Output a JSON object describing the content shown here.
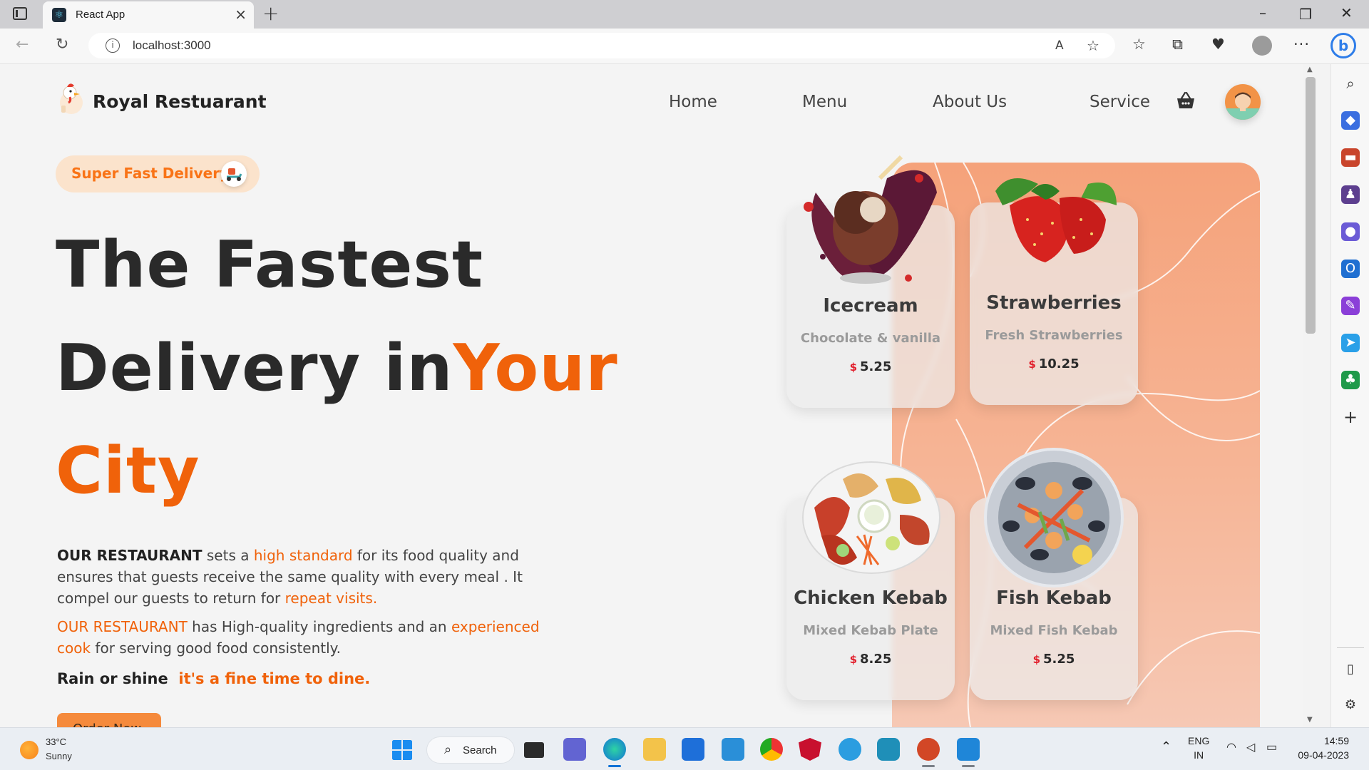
{
  "browser": {
    "tab_title": "React App",
    "url": "localhost:3000"
  },
  "site": {
    "brand": "Royal Restuarant",
    "nav": [
      "Home",
      "Menu",
      "About Us",
      "Service"
    ]
  },
  "hero": {
    "badge": "Super Fast Delivery",
    "line1": "The Fastest",
    "line2_main": "Delivery in",
    "line2_accent": "Your",
    "line3_accent": "City",
    "para1": {
      "bold": "OUR RESTAURANT",
      "t1": " sets a ",
      "hl1": "high standard",
      "t2": " for its food quality and ensures that guests receive the same quality with every meal . It compel our guests to return for ",
      "hl2": "repeat visits."
    },
    "para2": {
      "hl1": "OUR RESTAURANT",
      "t1": " has High-quality ingredients and an ",
      "hl2": "experienced cook",
      "t2": " for serving good food consistently."
    },
    "tagline_main": "Rain or shine",
    "tagline_accent": "it's a fine time to dine.",
    "cta": "Order Now"
  },
  "cards": [
    {
      "title": "Icecream",
      "subtitle": "Chocolate & vanilla",
      "currency": "$",
      "price": "5.25"
    },
    {
      "title": "Strawberries",
      "subtitle": "Fresh Strawberries",
      "currency": "$",
      "price": "10.25"
    },
    {
      "title": "Chicken Kebab",
      "subtitle": "Mixed Kebab Plate",
      "currency": "$",
      "price": "8.25"
    },
    {
      "title": "Fish Kebab",
      "subtitle": "Mixed Fish Kebab",
      "currency": "$",
      "price": "5.25"
    }
  ],
  "taskbar": {
    "temp": "33°C",
    "condition": "Sunny",
    "search": "Search",
    "lang1": "ENG",
    "lang2": "IN",
    "time": "14:59",
    "date": "09-04-2023"
  },
  "colors": {
    "accent": "#f0620a",
    "panel": "#f5a27a",
    "card_bg": "#ececec"
  }
}
